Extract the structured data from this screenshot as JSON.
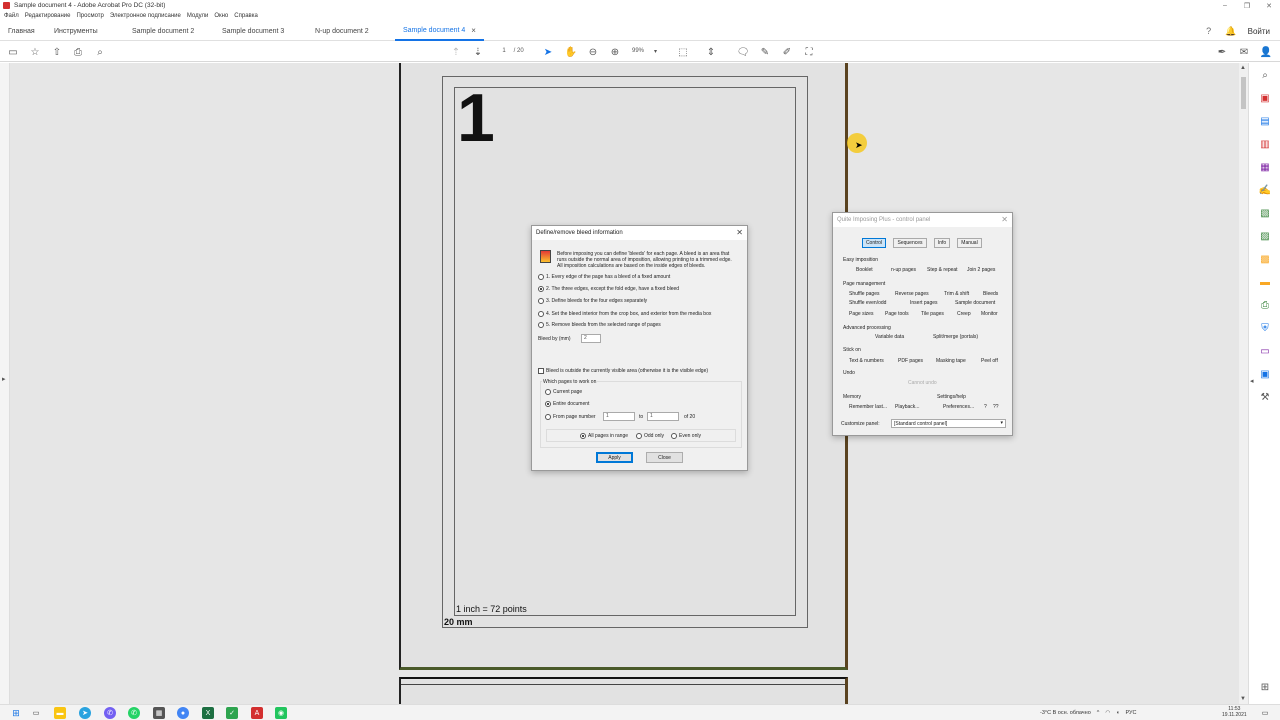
{
  "window": {
    "title": "Sample document 4 - Adobe Acrobat Pro DC (32-bit)",
    "controls": [
      "–",
      "❐",
      "✕"
    ]
  },
  "menu": [
    "Файл",
    "Редактирование",
    "Просмотр",
    "Электронное подписание",
    "Модули",
    "Окно",
    "Справка"
  ],
  "tabs": {
    "home": "Главная",
    "tools": "Инструменты",
    "docs": [
      "Sample document 2",
      "Sample document 3",
      "N-up document 2",
      "Sample document 4"
    ],
    "login": "Войти"
  },
  "toolbar": {
    "page_current": "1",
    "page_total": "/ 20",
    "zoom": "99%"
  },
  "page": {
    "number": "1",
    "inch_label": "1 inch = 72 points",
    "mm_label": "20 mm"
  },
  "bleed_dialog": {
    "title": "Define/remove bleed information",
    "intro": [
      "Before imposing you can define 'bleeds' for each page. A bleed is an area that",
      "runs outside the normal area of imposition, allowing printing to a trimmed edge.",
      "All imposition calculations are based on the inside edges of bleeds."
    ],
    "options": [
      "1. Every edge of the page has a bleed of a fixed amount",
      "2. The three edges, except the fold edge, have a fixed bleed",
      "3. Define bleeds for the four edges separately",
      "4. Set the bleed interior from the crop box, and exterior from the media box",
      "5. Remove bleeds from the selected range of pages"
    ],
    "selected_option": 1,
    "bleed_label": "Bleed by (mm)",
    "bleed_value": "2",
    "outside_checkbox": "Bleed is outside the currently visible area (otherwise it is the visible edge)",
    "which_pages": "Which pages to work on",
    "current_page": "Current page",
    "entire_document": "Entire document",
    "from_page": "From page number",
    "from_value": "1",
    "to_label": "to",
    "to_value": "1",
    "of_label": "of 20",
    "all_pages": "All pages in range",
    "odd_only": "Odd only",
    "even_only": "Even only",
    "apply": "Apply",
    "close": "Close"
  },
  "qi_panel": {
    "title": "Quite Imposing Plus - control panel",
    "tabs": [
      "Control",
      "Sequences",
      "Info",
      "Manual"
    ],
    "easy_imposition": "Easy imposition",
    "easy": [
      "Booklet",
      "n-up pages",
      "Step & repeat",
      "Join 2 pages"
    ],
    "page_management": "Page management",
    "pm_row1": [
      "Shuffle pages",
      "Reverse pages",
      "Trim & shift",
      "Bleeds"
    ],
    "pm_row2": [
      "Shuffle even/odd",
      "Insert pages",
      "Sample document"
    ],
    "pm_row3": [
      "Page sizes",
      "Page tools",
      "Tile pages",
      "Creep",
      "Monitor"
    ],
    "advanced": "Advanced processing",
    "adv": [
      "Variable data",
      "Split/merge (portals)"
    ],
    "stick_on": "Stick on",
    "stick": [
      "Text & numbers",
      "PDF pages",
      "Masking tape",
      "Peel off"
    ],
    "undo": "Undo",
    "cannot_undo": "Cannot undo",
    "memory": "Memory",
    "memory_btns": [
      "Remember last...",
      "Playback..."
    ],
    "settings": "Settings/help",
    "settings_btns": [
      "Preferences...",
      "?",
      "??"
    ],
    "customize_label": "Customize panel:",
    "customize_value": "[Standard control panel]"
  },
  "taskbar": {
    "weather": "-3°C  В осн. облачно",
    "lang": "РУС",
    "time": "11:53",
    "date": "19.11.2021"
  },
  "colors": {
    "accent": "#1473e6",
    "cursor_highlight": "#f5c81e"
  }
}
